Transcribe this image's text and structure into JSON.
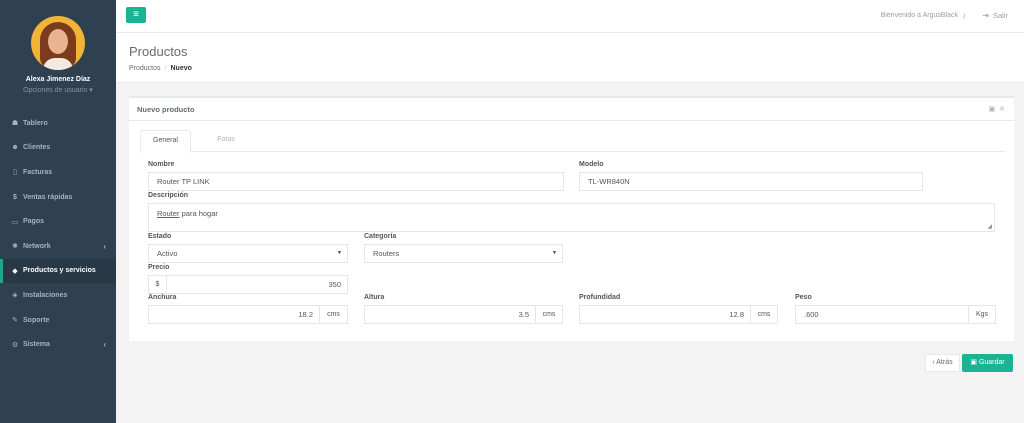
{
  "user": {
    "name": "Alexa Jimenez Díaz",
    "options_label": "Opciones de usuario ▾"
  },
  "sidebar": {
    "items": [
      {
        "label": "Tablero",
        "icon": "dashboard-icon",
        "glyph": "☗"
      },
      {
        "label": "Clientes",
        "icon": "users-icon",
        "glyph": "☻"
      },
      {
        "label": "Facturas",
        "icon": "file-icon",
        "glyph": "▯"
      },
      {
        "label": "Ventas rápidas",
        "icon": "dollar-icon",
        "glyph": "$"
      },
      {
        "label": "Pagos",
        "icon": "card-icon",
        "glyph": "▭"
      },
      {
        "label": "Network",
        "icon": "network-icon",
        "glyph": "✱",
        "arrow": "‹"
      },
      {
        "label": "Productos y servicios",
        "icon": "tag-icon",
        "glyph": "◆",
        "active": true
      },
      {
        "label": "Instalaciones",
        "icon": "tool-icon",
        "glyph": "◈"
      },
      {
        "label": "Soporte",
        "icon": "wrench-icon",
        "glyph": "✎"
      },
      {
        "label": "Sistema",
        "icon": "cogs-icon",
        "glyph": "⚙",
        "arrow": "‹"
      }
    ]
  },
  "topbar": {
    "menu_glyph": "≡",
    "welcome": "Bienvenido a ArgusBlack",
    "bell_glyph": "♪",
    "logout_glyph": "⇥",
    "logout_label": "Salir"
  },
  "heading": {
    "title": "Productos",
    "crumb_1": "Productos",
    "crumb_sep": "/",
    "crumb_2": "Nuevo"
  },
  "panel": {
    "title": "Nuevo producto",
    "tools": "▣ ✕",
    "tabs": [
      "General",
      "Fotos"
    ]
  },
  "form": {
    "nombre_label": "Nombre",
    "nombre_value": "Router TP LINK",
    "modelo_label": "Modelo",
    "modelo_value": "TL-WR840N",
    "descripcion_label": "Descripción",
    "descripcion_word1": "Router",
    "descripcion_rest": " para hogar",
    "estado_label": "Estado",
    "estado_value": "Activo",
    "categoria_label": "Categoría",
    "categoria_value": "Routers",
    "precio_label": "Precio",
    "precio_prefix": "$",
    "precio_value": "350",
    "anchura_label": "Anchura",
    "anchura_value": "18.2",
    "anchura_unit": "cms",
    "altura_label": "Altura",
    "altura_value": "3.5",
    "altura_unit": "cms",
    "profundidad_label": "Profundidad",
    "profundidad_value": "12.8",
    "profundidad_unit": "cms",
    "peso_label": "Peso",
    "peso_value": ".600",
    "peso_unit": "Kgs",
    "select_arrow": "▼"
  },
  "actions": {
    "back_label": "‹ Atrás",
    "save_glyph": "▣",
    "save_label": "Guardar"
  },
  "colors": {
    "sidebar_bg": "#2f4050",
    "accent": "#1ab394"
  }
}
